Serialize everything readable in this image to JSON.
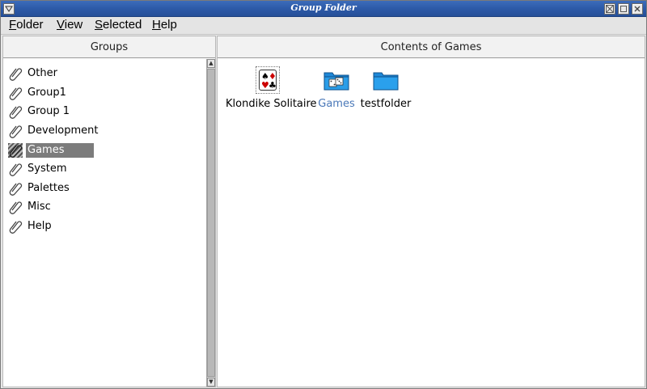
{
  "window": {
    "title": "Group Folder"
  },
  "menubar": [
    {
      "label": "Folder",
      "underline": "F",
      "rest": "older"
    },
    {
      "label": "View",
      "underline": "V",
      "rest": "iew"
    },
    {
      "label": "Selected",
      "underline": "S",
      "rest": "elected"
    },
    {
      "label": "Help",
      "underline": "H",
      "rest": "elp"
    }
  ],
  "groups": {
    "header": "Groups",
    "items": [
      "Other",
      "Group1",
      "Group 1",
      "Development",
      "Games",
      "System",
      "Palettes",
      "Misc",
      "Help"
    ],
    "selected": "Games"
  },
  "contents": {
    "header": "Contents of Games",
    "items": [
      {
        "label": "Klondike Solitaire",
        "icon": "playing-cards-icon"
      },
      {
        "label": "Games",
        "icon": "folder-dice-icon",
        "selected": true
      },
      {
        "label": "testfolder",
        "icon": "folder-icon"
      }
    ]
  },
  "colors": {
    "titlebar": "#2d5aa8",
    "selection": "#7c7c7c",
    "selected_label": "#4a78b8",
    "folder": "#1e88d8"
  }
}
